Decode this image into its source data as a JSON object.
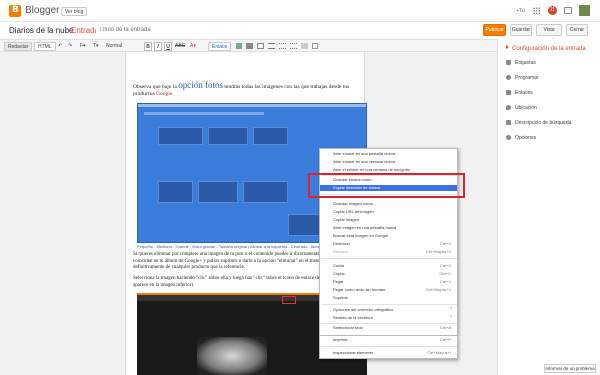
{
  "app": {
    "brand": "Blogger",
    "view_blog": "Ver blog",
    "plus_one": "+Tú",
    "notifications": "11"
  },
  "post": {
    "blog_name": "Diarios de la nube",
    "separator": "·",
    "entry_label": "Entrada",
    "title_placeholder": "Título de la entrada"
  },
  "actions": {
    "publish": "Publicar",
    "save": "Guardar",
    "preview": "Vista previa",
    "close": "Cerrar"
  },
  "toolbar": {
    "compose": "Redactar",
    "html": "HTML",
    "undo": "↶",
    "redo": "↷",
    "font_family": "F▾",
    "font_size": "T▾",
    "format": "Normal",
    "bold": "B",
    "italic": "I",
    "underline": "U",
    "strike": "ABC",
    "text_color": "A▾",
    "link": "Enlace"
  },
  "sidebar": {
    "header": "Configuración de la entrada",
    "items": [
      {
        "label": "Etiquetas",
        "icon": "tag-icon"
      },
      {
        "label": "Programar",
        "icon": "clock-icon"
      },
      {
        "label": "Enlaces",
        "icon": "link-icon"
      },
      {
        "label": "Ubicación",
        "icon": "location-icon"
      },
      {
        "label": "Descripción de búsqueda",
        "icon": "search-description-icon"
      },
      {
        "label": "Opciones",
        "icon": "gear-icon"
      }
    ],
    "report": "Informar de un problema"
  },
  "document": {
    "para1_a": "Observa que bajo la ",
    "para1_link": "opción fotos",
    "para1_b": " tendrás todas las imágenes con las que trabajas desde tus productos ",
    "para1_google": "Google",
    "para1_end": ".",
    "caption": "Pequeño - Mediano - Grande - Extra grande - Tamaño original | Alinear a la izquierda - Centrado - Alinear a la derecha",
    "para2": "Si quieres eliminar por completo una imagen de tu post o el contenido puedes ir directamente al álbum y, si coinciden en tu álbum de Google+ y pulsar suprimir o darle a la opción \"eliminar\" en el menú que desaparecerá definitivamente de cualquier producto que la referencie.",
    "para3": "Selecciona la imagen haciendo \"clic\" sobre ella y luego haz \"clic\" sobre el icono de enlace de la izquierda (como aparece en la imagen inferior)."
  },
  "context_menu": {
    "items": [
      {
        "label": "Abrir enlace en una pestaña nueva",
        "key": ""
      },
      {
        "label": "Abrir enlace en una ventana nueva",
        "key": ""
      },
      {
        "label": "Abrir el enlace en una ventana de incógnito",
        "key": ""
      },
      {
        "label": "Guardar enlace como...",
        "key": ""
      },
      {
        "label": "Copiar dirección de enlace",
        "key": ""
      },
      {
        "label": "Guardar imagen como...",
        "key": ""
      },
      {
        "label": "Copiar URL de imagen",
        "key": ""
      },
      {
        "label": "Copiar imagen",
        "key": ""
      },
      {
        "label": "Abrir imagen en una pestaña nueva",
        "key": ""
      },
      {
        "label": "Buscar esta imagen en Google",
        "key": ""
      },
      {
        "label": "Deshacer",
        "key": "Ctrl+Z"
      },
      {
        "label": "Rehacer",
        "key": "Ctrl+Mayús+Z"
      },
      {
        "label": "Cortar",
        "key": "Ctrl+X"
      },
      {
        "label": "Copiar",
        "key": "Ctrl+C"
      },
      {
        "label": "Pegar",
        "key": "Ctrl+V"
      },
      {
        "label": "Pegar como texto sin formato",
        "key": "Ctrl+Mayús+V"
      },
      {
        "label": "Suprimir",
        "key": ""
      },
      {
        "label": "Opciones del corrector ortográfico",
        "key": ""
      },
      {
        "label": "Sentido de la escritura",
        "key": ""
      },
      {
        "label": "Seleccionar todo",
        "key": "Ctrl+A"
      },
      {
        "label": "Imprimir...",
        "key": "Ctrl+P"
      },
      {
        "label": "Inspeccionar elemento",
        "key": "Ctrl+Mayús+I"
      }
    ]
  },
  "colors": {
    "accent_orange": "#f57d00",
    "highlight_blue": "#3d73e0",
    "crumb_red": "#dd4b39",
    "annotation_red": "#e0202a"
  }
}
